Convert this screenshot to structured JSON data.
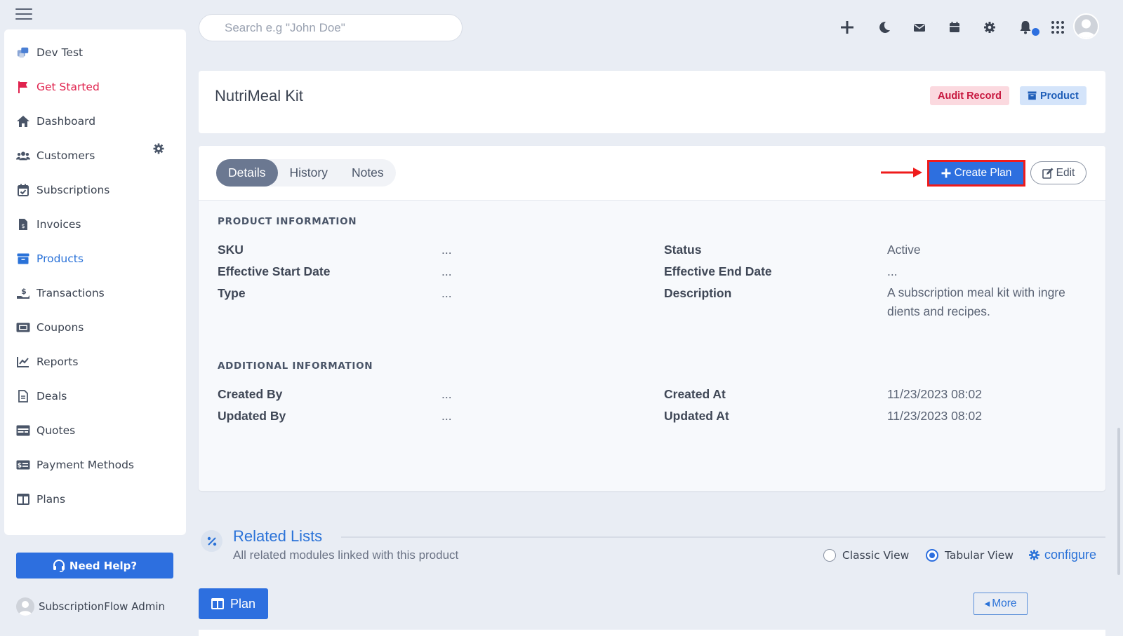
{
  "sidebar": {
    "items": [
      {
        "label": "Dev Test",
        "icon": "dev-test-logo-icon"
      },
      {
        "label": "Get Started",
        "icon": "flag-icon"
      },
      {
        "label": "Dashboard",
        "icon": "home-icon"
      },
      {
        "label": "Customers",
        "icon": "users-icon"
      },
      {
        "label": "Subscriptions",
        "icon": "calendar-check-icon"
      },
      {
        "label": "Invoices",
        "icon": "invoice-icon"
      },
      {
        "label": "Products",
        "icon": "archive-box-icon"
      },
      {
        "label": "Transactions",
        "icon": "hand-dollar-icon"
      },
      {
        "label": "Coupons",
        "icon": "ticket-icon"
      },
      {
        "label": "Reports",
        "icon": "chart-line-icon"
      },
      {
        "label": "Deals",
        "icon": "file-icon"
      },
      {
        "label": "Quotes",
        "icon": "quote-card-icon"
      },
      {
        "label": "Payment Methods",
        "icon": "money-card-icon"
      },
      {
        "label": "Plans",
        "icon": "columns-icon"
      }
    ],
    "help_label": "Need Help?",
    "admin_name": "SubscriptionFlow Admin"
  },
  "topbar": {
    "search_placeholder": "Search e.g \"John Doe\"",
    "icons": [
      "plus-icon",
      "moon-icon",
      "mail-icon",
      "calendar-icon",
      "gear-icon",
      "bell-icon",
      "apps-grid-icon",
      "user-avatar"
    ]
  },
  "record": {
    "title": "NutriMeal Kit",
    "badge_audit": "Audit Record",
    "badge_product": "Product"
  },
  "tabs": [
    "Details",
    "History",
    "Notes"
  ],
  "actions": {
    "create_plan": "Create Plan",
    "edit": "Edit"
  },
  "product_info": {
    "heading": "PRODUCT INFORMATION",
    "sku_label": "SKU",
    "sku_value": "...",
    "start_label": "Effective Start Date",
    "start_value": "...",
    "type_label": "Type",
    "type_value": "...",
    "status_label": "Status",
    "status_value": "Active",
    "end_label": "Effective End Date",
    "end_value": "...",
    "desc_label": "Description",
    "desc_value": "A subscription meal kit with ingre dients and recipes."
  },
  "additional_info": {
    "heading": "ADDITIONAL INFORMATION",
    "created_by_label": "Created By",
    "created_by_value": "...",
    "updated_by_label": "Updated By",
    "updated_by_value": "...",
    "created_at_label": "Created At",
    "created_at_value": "11/23/2023 08:02",
    "updated_at_label": "Updated At",
    "updated_at_value": "11/23/2023 08:02"
  },
  "related": {
    "title": "Related Lists",
    "subtitle": "All related modules linked with this product",
    "classic_view": "Classic View",
    "tabular_view": "Tabular View",
    "selected_view": "Tabular View",
    "configure": "configure",
    "plan_button": "Plan",
    "more_button": "More"
  },
  "colors": {
    "accent": "#2d6fdf",
    "danger": "#e0234e",
    "highlight_border": "#ef1b1b"
  }
}
